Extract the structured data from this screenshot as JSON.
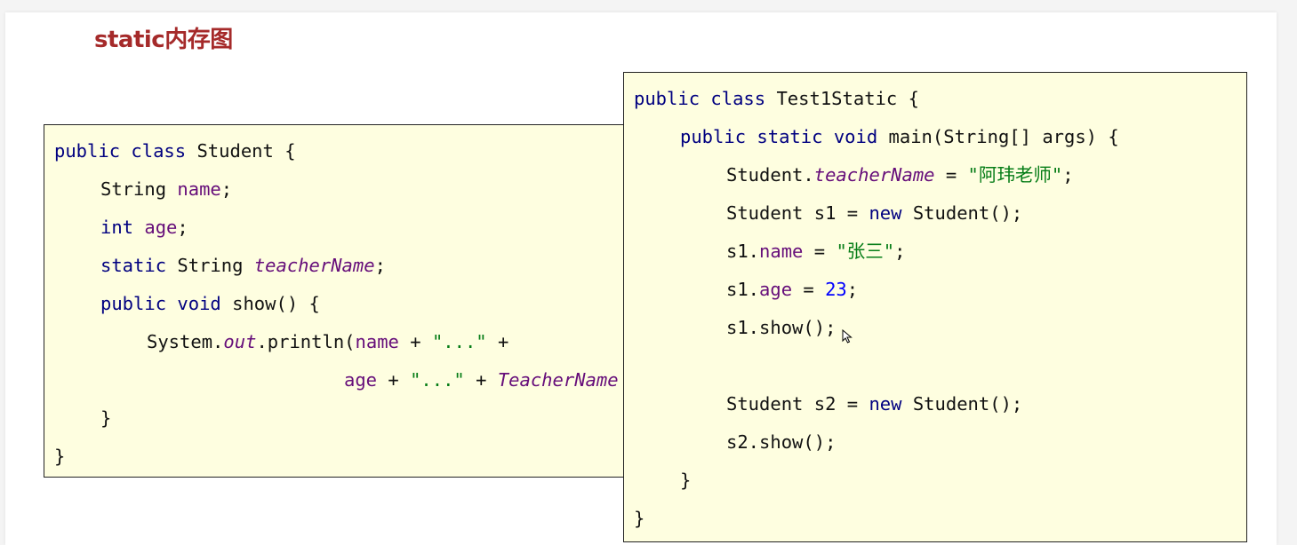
{
  "title": "static内存图",
  "left_code": {
    "l1": {
      "a": "public",
      "b": " ",
      "c": "class",
      "d": " Student {"
    },
    "l2": {
      "a": "String ",
      "b": "name",
      "c": ";"
    },
    "l3": {
      "a": "int",
      "b": " ",
      "c": "age",
      "d": ";"
    },
    "l4": {
      "a": "static",
      "b": " String ",
      "c": "teacherName",
      "d": ";"
    },
    "l5": {
      "a": "public",
      "b": " ",
      "c": "void",
      "d": " show() {"
    },
    "l6": {
      "a": "System.",
      "b": "out",
      "c": ".println(",
      "d": "name",
      "e": " + ",
      "f": "\"...\"",
      "g": " +"
    },
    "l7": {
      "a": "age",
      "b": " + ",
      "c": "\"...\"",
      "d": " + ",
      "e": "TeacherName"
    },
    "l8": {
      "a": "}"
    },
    "l9": {
      "a": "}"
    }
  },
  "right_code": {
    "l1": {
      "a": "public",
      "b": " ",
      "c": "class",
      "d": " Test1Static {"
    },
    "l2": {
      "a": "public",
      "b": " ",
      "c": "static",
      "d": " ",
      "e": "void",
      "f": " main(String[] args) {"
    },
    "l3": {
      "a": "Student.",
      "b": "teacherName",
      "c": " = ",
      "d": "\"阿玮老师\"",
      "e": ";"
    },
    "l4": {
      "a": "Student s1 = ",
      "b": "new",
      "c": " Student();"
    },
    "l5": {
      "a": "s1.",
      "b": "name",
      "c": " = ",
      "d": "\"张三\"",
      "e": ";"
    },
    "l6": {
      "a": "s1.",
      "b": "age",
      "c": " = ",
      "d": "23",
      "e": ";"
    },
    "l7": {
      "a": "s1.show();"
    },
    "l8": {
      "a": "Student s2 = ",
      "b": "new",
      "c": " Student();"
    },
    "l9": {
      "a": "s2.show();"
    },
    "l10": {
      "a": "}"
    },
    "l11": {
      "a": "}"
    }
  },
  "colors": {
    "title": "#a52a2a",
    "keyword": "#000080",
    "field": "#660e7a",
    "string": "#067d17",
    "number": "#0000ff",
    "code_background": "#fefee0"
  },
  "icons": {
    "cursor": "mouse-pointer-icon"
  }
}
